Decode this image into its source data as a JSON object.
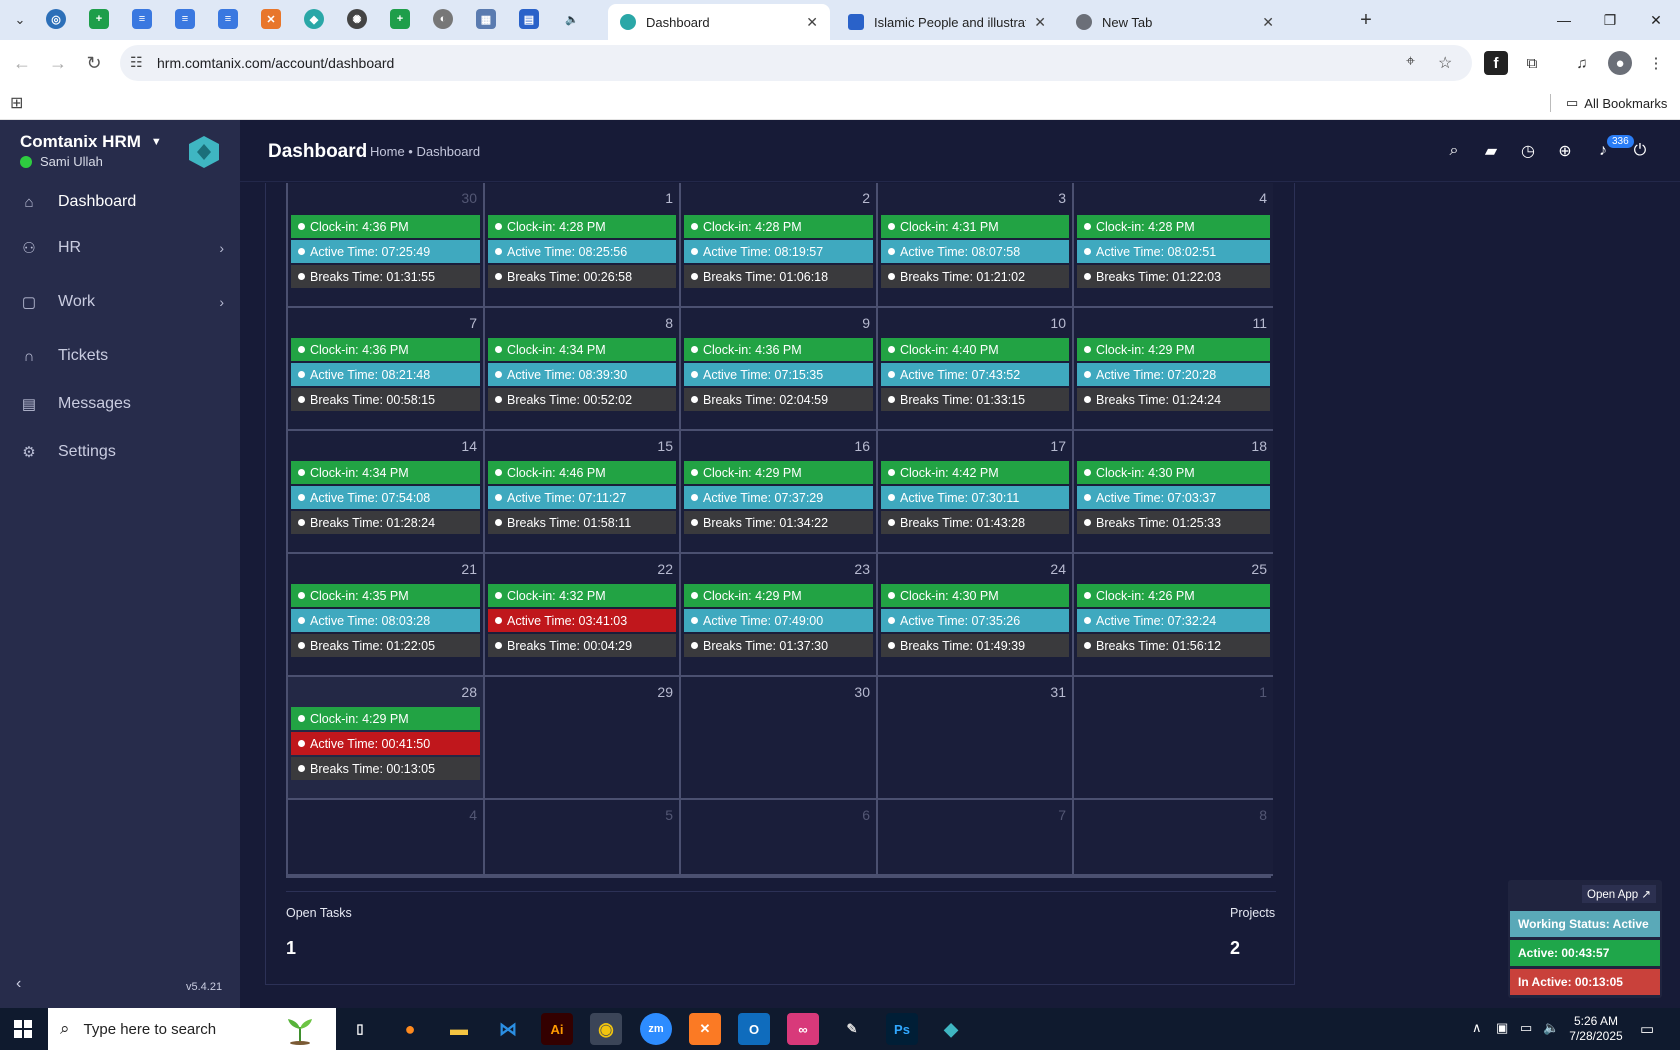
{
  "browser": {
    "tabs": [
      {
        "title": "Dashboard",
        "active": true
      },
      {
        "title": "Islamic People and illustration v",
        "active": false
      },
      {
        "title": "New Tab",
        "active": false
      }
    ],
    "url": "hrm.comtanix.com/account/dashboard",
    "bookmarks_label": "All Bookmarks",
    "colors": {
      "chrome": "#dfe8f6"
    }
  },
  "sidebar": {
    "brand": "Comtanix HRM",
    "user": "Sami Ullah",
    "items": [
      {
        "label": "Dashboard",
        "icon": "home-icon",
        "active": true
      },
      {
        "label": "HR",
        "icon": "users-icon",
        "has_children": true
      },
      {
        "label": "Work",
        "icon": "briefcase-icon",
        "has_children": true
      },
      {
        "label": "Tickets",
        "icon": "headset-icon"
      },
      {
        "label": "Messages",
        "icon": "message-icon"
      },
      {
        "label": "Settings",
        "icon": "gear-icon"
      }
    ],
    "version": "v5.4.21"
  },
  "header": {
    "title": "Dashboard",
    "breadcrumb": "Home • Dashboard",
    "notification_count": "336"
  },
  "calendar": {
    "rows": [
      [
        {
          "day": "30",
          "muted": true,
          "clock_in": "Clock-in: 4:36 PM",
          "active": "Active Time: 07:25:49",
          "breaks": "Breaks Time: 01:31:55"
        },
        {
          "day": "1",
          "clock_in": "Clock-in: 4:28 PM",
          "active": "Active Time: 08:25:56",
          "breaks": "Breaks Time: 00:26:58"
        },
        {
          "day": "2",
          "clock_in": "Clock-in: 4:28 PM",
          "active": "Active Time: 08:19:57",
          "breaks": "Breaks Time: 01:06:18"
        },
        {
          "day": "3",
          "clock_in": "Clock-in: 4:31 PM",
          "active": "Active Time: 08:07:58",
          "breaks": "Breaks Time: 01:21:02"
        },
        {
          "day": "4",
          "clock_in": "Clock-in: 4:28 PM",
          "active": "Active Time: 08:02:51",
          "breaks": "Breaks Time: 01:22:03"
        }
      ],
      [
        {
          "day": "7",
          "clock_in": "Clock-in: 4:36 PM",
          "active": "Active Time: 08:21:48",
          "breaks": "Breaks Time: 00:58:15"
        },
        {
          "day": "8",
          "clock_in": "Clock-in: 4:34 PM",
          "active": "Active Time: 08:39:30",
          "breaks": "Breaks Time: 00:52:02"
        },
        {
          "day": "9",
          "clock_in": "Clock-in: 4:36 PM",
          "active": "Active Time: 07:15:35",
          "breaks": "Breaks Time: 02:04:59"
        },
        {
          "day": "10",
          "clock_in": "Clock-in: 4:40 PM",
          "active": "Active Time: 07:43:52",
          "breaks": "Breaks Time: 01:33:15"
        },
        {
          "day": "11",
          "clock_in": "Clock-in: 4:29 PM",
          "active": "Active Time: 07:20:28",
          "breaks": "Breaks Time: 01:24:24"
        }
      ],
      [
        {
          "day": "14",
          "clock_in": "Clock-in: 4:34 PM",
          "active": "Active Time: 07:54:08",
          "breaks": "Breaks Time: 01:28:24"
        },
        {
          "day": "15",
          "clock_in": "Clock-in: 4:46 PM",
          "active": "Active Time: 07:11:27",
          "breaks": "Breaks Time: 01:58:11"
        },
        {
          "day": "16",
          "clock_in": "Clock-in: 4:29 PM",
          "active": "Active Time: 07:37:29",
          "breaks": "Breaks Time: 01:34:22"
        },
        {
          "day": "17",
          "clock_in": "Clock-in: 4:42 PM",
          "active": "Active Time: 07:30:11",
          "breaks": "Breaks Time: 01:43:28"
        },
        {
          "day": "18",
          "clock_in": "Clock-in: 4:30 PM",
          "active": "Active Time: 07:03:37",
          "breaks": "Breaks Time: 01:25:33"
        }
      ],
      [
        {
          "day": "21",
          "clock_in": "Clock-in: 4:35 PM",
          "active": "Active Time: 08:03:28",
          "breaks": "Breaks Time: 01:22:05"
        },
        {
          "day": "22",
          "clock_in": "Clock-in: 4:32 PM",
          "active": "Active Time: 03:41:03",
          "active_low": true,
          "breaks": "Breaks Time: 00:04:29"
        },
        {
          "day": "23",
          "clock_in": "Clock-in: 4:29 PM",
          "active": "Active Time: 07:49:00",
          "breaks": "Breaks Time: 01:37:30"
        },
        {
          "day": "24",
          "clock_in": "Clock-in: 4:30 PM",
          "active": "Active Time: 07:35:26",
          "breaks": "Breaks Time: 01:49:39"
        },
        {
          "day": "25",
          "clock_in": "Clock-in: 4:26 PM",
          "active": "Active Time: 07:32:24",
          "breaks": "Breaks Time: 01:56:12"
        }
      ],
      [
        {
          "day": "28",
          "today": true,
          "clock_in": "Clock-in: 4:29 PM",
          "active": "Active Time: 00:41:50",
          "active_low": true,
          "breaks": "Breaks Time: 00:13:05"
        },
        {
          "day": "29"
        },
        {
          "day": "30"
        },
        {
          "day": "31"
        },
        {
          "day": "1",
          "muted": true
        }
      ],
      [
        {
          "day": "4",
          "muted": true
        },
        {
          "day": "5",
          "muted": true
        },
        {
          "day": "6",
          "muted": true
        },
        {
          "day": "7",
          "muted": true
        },
        {
          "day": "8",
          "muted": true
        }
      ]
    ],
    "colors": {
      "clock_in": "#22a344",
      "active": "#3fa9bf",
      "active_low": "#c0171c",
      "breaks": "#3a3a3d"
    }
  },
  "summary": {
    "open_tasks_label": "Open Tasks",
    "open_tasks_value": "1",
    "projects_label": "Projects",
    "projects_value": "2"
  },
  "widget": {
    "open_app": "Open App ↗",
    "status": "Working Status: Active",
    "active": "Active: 00:43:57",
    "inactive": "In Active: 00:13:05",
    "colors": {
      "status": "#5aa9b8",
      "active": "#1fa64a",
      "inactive": "#c9413b"
    }
  },
  "taskbar": {
    "search_placeholder": "Type here to search",
    "time": "5:26 AM",
    "date": "7/28/2025"
  }
}
